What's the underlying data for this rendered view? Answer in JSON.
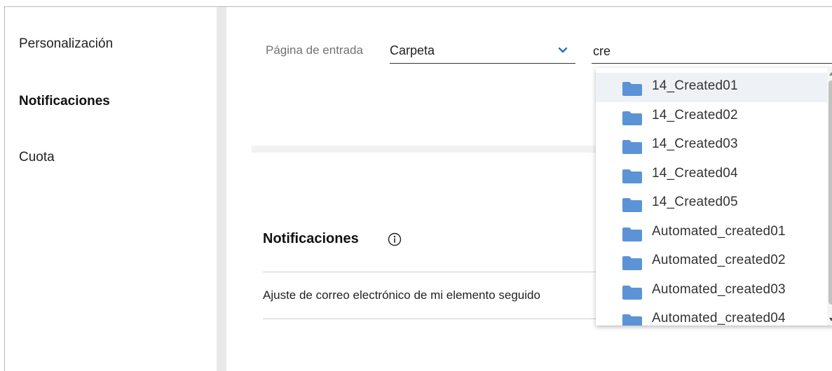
{
  "sidebar": {
    "items": [
      {
        "label": "Personalización"
      },
      {
        "label": "Notificaciones"
      },
      {
        "label": "Cuota"
      }
    ]
  },
  "entry_page": {
    "label": "Página de entrada",
    "selected": "Carpeta"
  },
  "search": {
    "value": "cre"
  },
  "dropdown": {
    "items": [
      {
        "label": "14_Created01"
      },
      {
        "label": "14_Created02"
      },
      {
        "label": "14_Created03"
      },
      {
        "label": "14_Created04"
      },
      {
        "label": "14_Created05"
      },
      {
        "label": "Automated_created01"
      },
      {
        "label": "Automated_created02"
      },
      {
        "label": "Automated_created03"
      },
      {
        "label": "Automated_created04"
      }
    ]
  },
  "notifications": {
    "heading": "Notificaciones",
    "email_setting": "Ajuste de correo electrónico de mi elemento seguido"
  },
  "colors": {
    "folder": "#5b93d6",
    "chevron": "#1f6fd1",
    "highlight": "#eef2f6"
  },
  "icons": {
    "folder": "folder-icon",
    "chevron": "chevron-down-icon",
    "info": "info-icon"
  }
}
